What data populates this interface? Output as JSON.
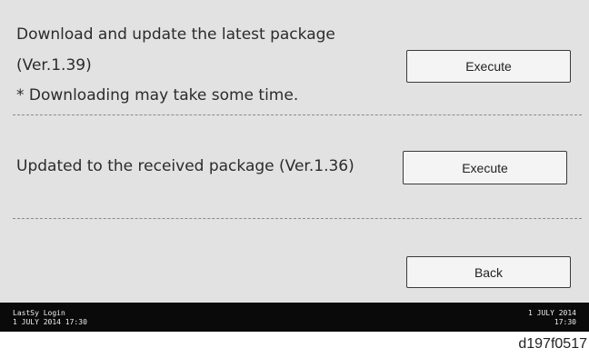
{
  "section1": {
    "line1": "Download and update the latest package",
    "line2": "(Ver.1.39)",
    "line3": "* Downloading may take some time.",
    "button_label": "Execute"
  },
  "section2": {
    "text": "Updated to the received package (Ver.1.36)",
    "button_label": "Execute"
  },
  "back_label": "Back",
  "status_bar": {
    "left_line1": "LastSy Login",
    "left_line2": "1 JULY  2014  17:30",
    "right_line1": "1 JULY  2014",
    "right_line2": "17:30"
  },
  "figure_id": "d197f0517"
}
